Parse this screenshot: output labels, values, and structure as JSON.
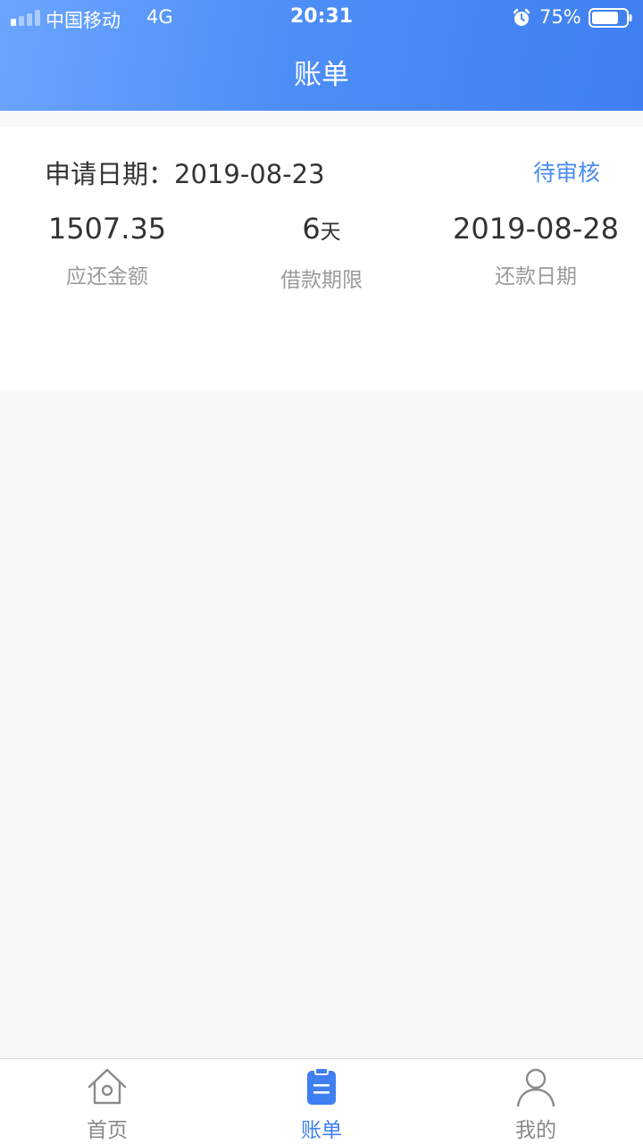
{
  "status_bar": {
    "carrier": "中国移动",
    "network": "4G",
    "time": "20:31",
    "battery_percent": "75%",
    "icons": [
      "signal-icon",
      "alarm-icon",
      "battery-icon"
    ]
  },
  "header": {
    "title": "账单"
  },
  "bill": {
    "apply_label": "申请日期：",
    "apply_date": "2019-08-23",
    "status": "待审核",
    "amount": {
      "value": "1507.35",
      "label": "应还金额"
    },
    "term": {
      "value": "6",
      "unit": "天",
      "label": "借款期限"
    },
    "due": {
      "value": "2019-08-28",
      "label": "还款日期"
    }
  },
  "tabbar": {
    "items": [
      {
        "label": "首页",
        "icon": "home-icon",
        "active": false
      },
      {
        "label": "账单",
        "icon": "bill-icon",
        "active": true
      },
      {
        "label": "我的",
        "icon": "user-icon",
        "active": false
      }
    ]
  },
  "colors": {
    "accent": "#3f7ff1",
    "status_link": "#4a8cf0",
    "background": "#f8f8f8"
  }
}
